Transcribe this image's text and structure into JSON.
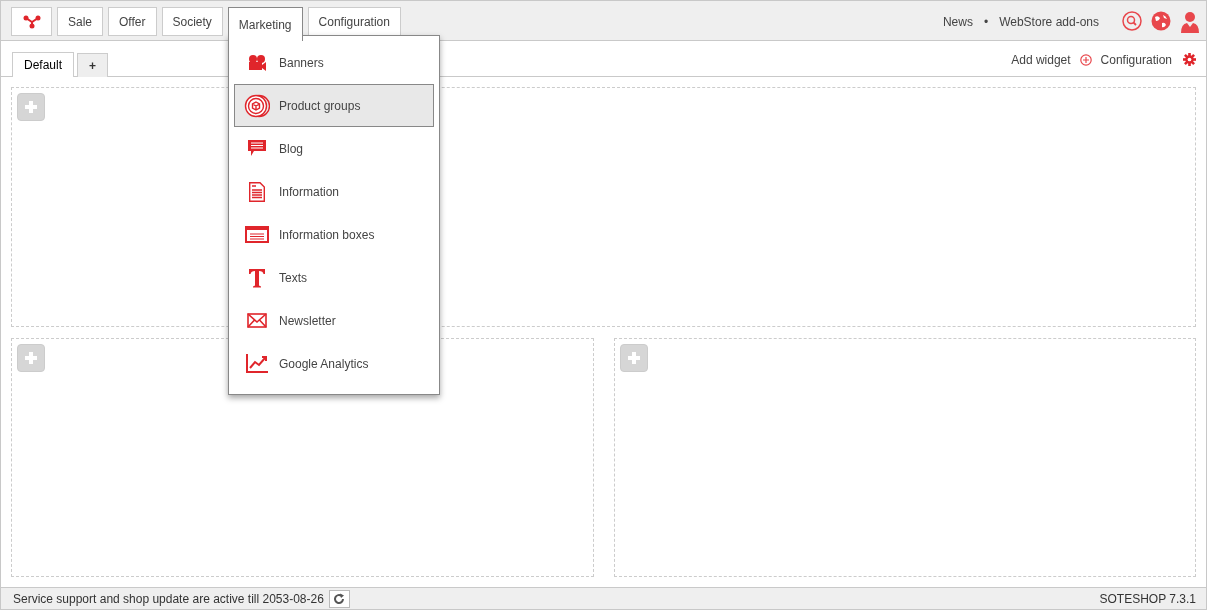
{
  "top_nav": {
    "items": [
      {
        "label": "Sale",
        "selected": false
      },
      {
        "label": "Offer",
        "selected": false
      },
      {
        "label": "Society",
        "selected": false
      },
      {
        "label": "Marketing",
        "selected": true
      },
      {
        "label": "Configuration",
        "selected": false
      }
    ],
    "links": [
      "News",
      "WebStore add-ons"
    ],
    "separator": "•"
  },
  "marketing_menu": {
    "items": [
      {
        "label": "Banners",
        "selected": false
      },
      {
        "label": "Product groups",
        "selected": true
      },
      {
        "label": "Blog",
        "selected": false
      },
      {
        "label": "Information",
        "selected": false
      },
      {
        "label": "Information boxes",
        "selected": false
      },
      {
        "label": "Texts",
        "selected": false
      },
      {
        "label": "Newsletter",
        "selected": false
      },
      {
        "label": "Google Analytics",
        "selected": false
      }
    ]
  },
  "dashboard_tabs": [
    {
      "label": "Default",
      "selected": true
    },
    {
      "label": "+",
      "selected": false
    }
  ],
  "toolbar": {
    "add_widget": "Add widget",
    "configuration": "Configuration"
  },
  "status_bar": {
    "message": "Service support and shop update are active till 2053-08-26",
    "version": "SOTESHOP 7.3.1"
  }
}
